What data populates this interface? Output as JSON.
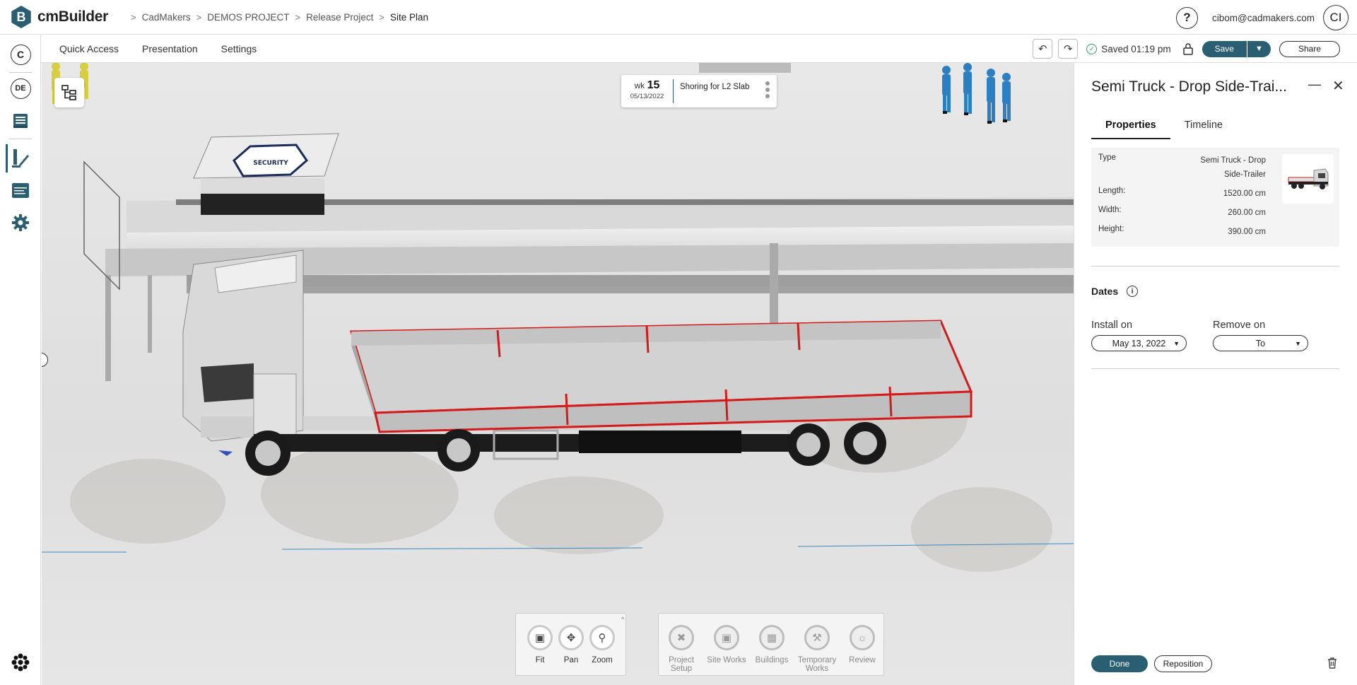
{
  "app": {
    "logo_letter": "B",
    "name": "cmBuilder"
  },
  "breadcrumb": [
    "CadMakers",
    "DEMOS PROJECT",
    "Release Project",
    "Site Plan"
  ],
  "header": {
    "help": "?",
    "user_email": "cibom@cadmakers.com",
    "avatar_initials": "CI"
  },
  "rail": {
    "company_initial": "C",
    "language": "DE"
  },
  "menu": {
    "quick_access": "Quick Access",
    "presentation": "Presentation",
    "settings": "Settings"
  },
  "status": {
    "saved_text": "Saved 01:19 pm"
  },
  "actions": {
    "save": "Save",
    "share": "Share"
  },
  "week_card": {
    "wk_label": "wk",
    "week": "15",
    "date": "05/13/2022",
    "task": "Shoring for L2 Slab"
  },
  "scene": {
    "sign_text": "SECURITY"
  },
  "nav_tools": [
    {
      "label": "Fit",
      "icon": "fit-icon"
    },
    {
      "label": "Pan",
      "icon": "pan-icon"
    },
    {
      "label": "Zoom",
      "icon": "zoom-icon"
    }
  ],
  "section_tools": [
    {
      "label": "Project Setup",
      "icon": "project-setup-icon"
    },
    {
      "label": "Site Works",
      "icon": "site-works-icon"
    },
    {
      "label": "Buildings",
      "icon": "buildings-icon"
    },
    {
      "label": "Temporary Works",
      "icon": "temporary-works-icon"
    },
    {
      "label": "Review",
      "icon": "review-icon"
    }
  ],
  "panel": {
    "title": "Semi Truck - Drop Side-Trai...",
    "tabs": [
      "Properties",
      "Timeline"
    ],
    "properties": {
      "type_label": "Type",
      "type_value": "Semi Truck - Drop Side-Trailer",
      "length_label": "Length:",
      "length_value": "1520.00 cm",
      "width_label": "Width:",
      "width_value": "260.00 cm",
      "height_label": "Height:",
      "height_value": "390.00 cm"
    },
    "dates": {
      "title": "Dates",
      "install_label": "Install on",
      "install_value": "May 13, 2022",
      "remove_label": "Remove on",
      "remove_value": "To"
    },
    "done": "Done",
    "reposition": "Reposition"
  },
  "colors": {
    "brand": "#2a5f73",
    "selection": "#d41a1a",
    "saved_check": "#2fa26b"
  }
}
